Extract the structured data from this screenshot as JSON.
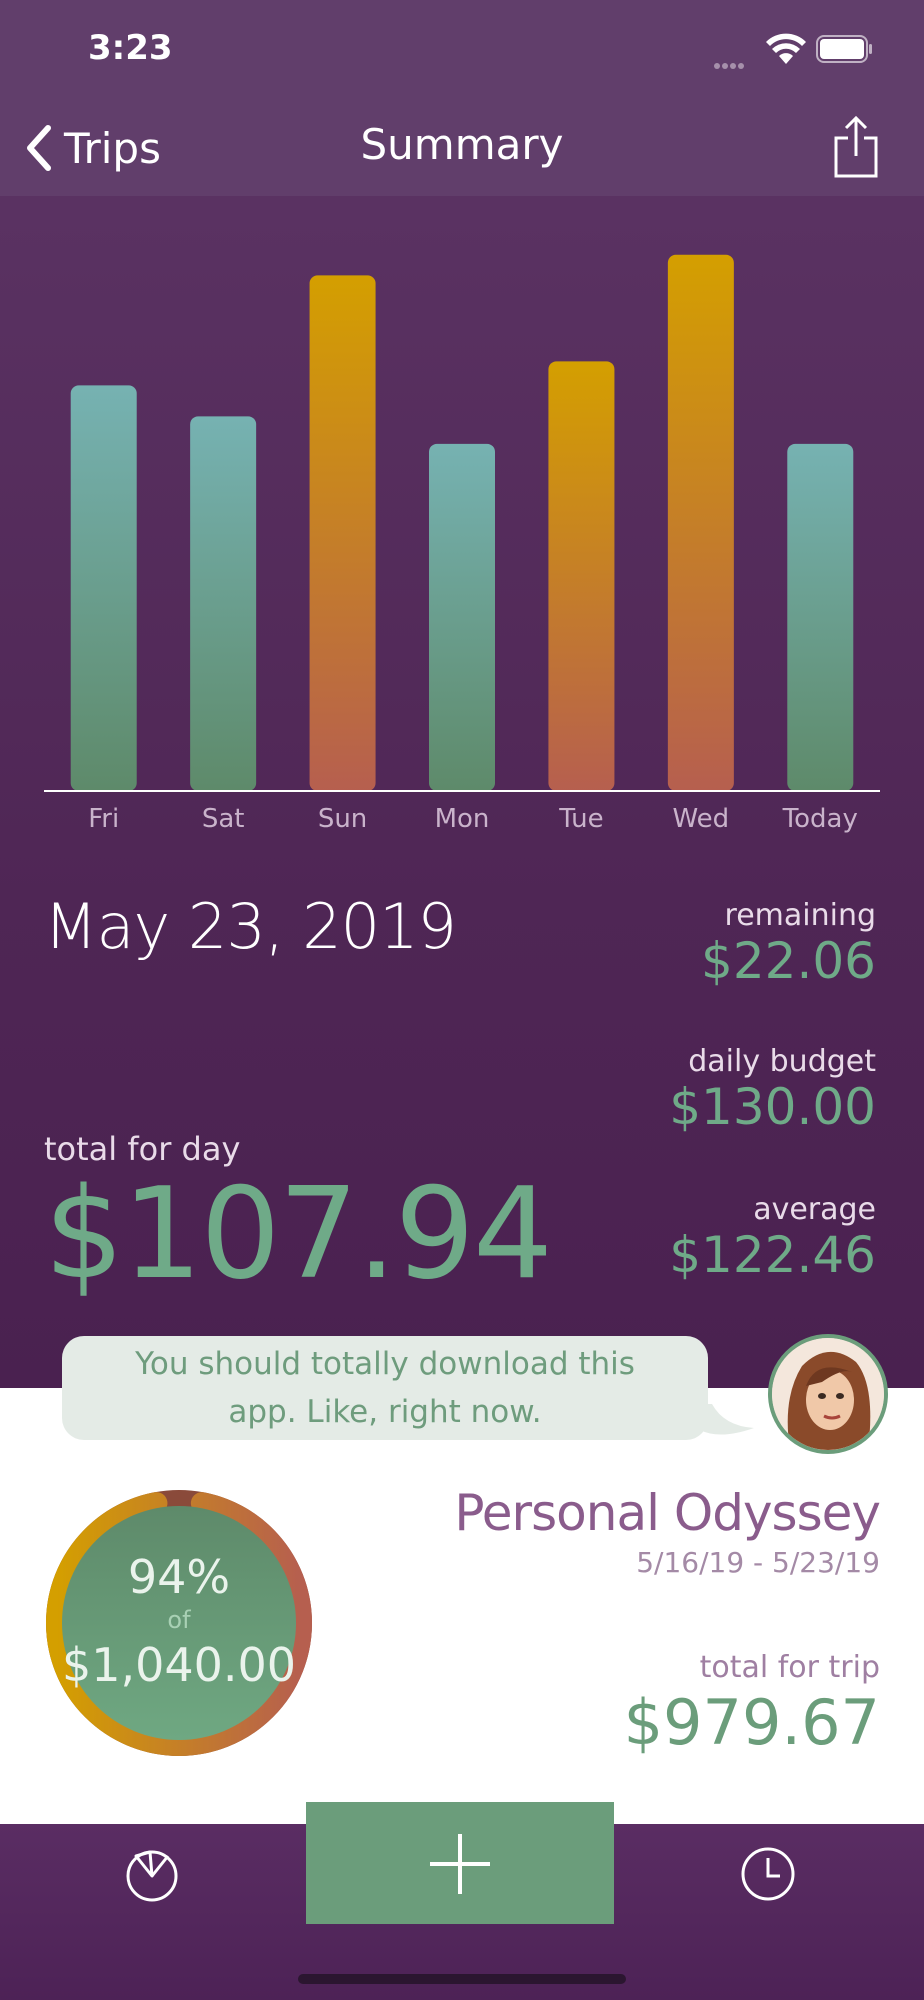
{
  "status_bar": {
    "time": "3:23"
  },
  "nav": {
    "back_label": "Trips",
    "title": "Summary"
  },
  "chart_data": {
    "type": "bar",
    "categories": [
      "Fri",
      "Sat",
      "Sun",
      "Mon",
      "Tue",
      "Wed",
      "Today"
    ],
    "values": [
      118,
      109,
      150,
      101,
      125,
      156,
      101
    ],
    "over_budget": [
      false,
      false,
      true,
      false,
      true,
      true,
      false
    ],
    "ylim": [
      0,
      160
    ],
    "colors": {
      "under_top": "#76b2b2",
      "under_bottom": "#5e8a6a",
      "over_top": "#d49f00",
      "over_bottom": "#b65f4f"
    }
  },
  "day": {
    "date": "May 23, 2019",
    "remaining_label": "remaining",
    "remaining_value": "$22.06",
    "daily_budget_label": "daily budget",
    "daily_budget_value": "$130.00",
    "average_label": "average",
    "average_value": "$122.46",
    "total_label": "total for day",
    "total_value": "$107.94"
  },
  "message": {
    "text": "You should totally download this app. Like, right now."
  },
  "trip": {
    "percent": "94%",
    "of_label": "of",
    "budget": "$1,040.00",
    "progress": 0.94,
    "name": "Personal Odyssey",
    "dates": "5/16/19 - 5/23/19",
    "total_label": "total for trip",
    "total_value": "$979.67"
  },
  "tabs": {
    "left_icon": "pie-chart-icon",
    "center_icon": "plus-icon",
    "right_icon": "clock-icon"
  },
  "colors": {
    "purple": "#5a3262",
    "green": "#6b9d7b",
    "mauve": "#8a5c8c"
  }
}
